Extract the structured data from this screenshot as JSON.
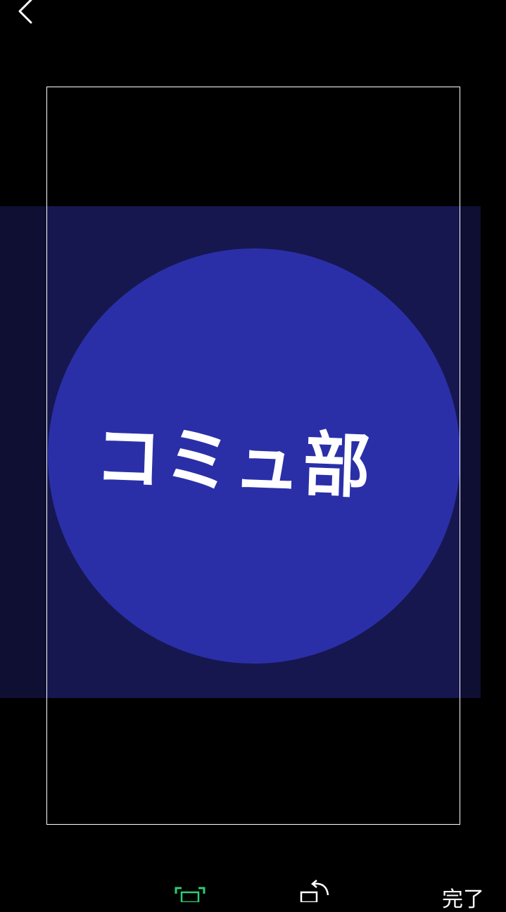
{
  "header": {
    "back_icon": "chevron-left-icon"
  },
  "image": {
    "logo_text": "コミュ部",
    "background_color": "#16174f",
    "circle_color": "#2a2fa8"
  },
  "toolbar": {
    "crop_icon": "crop-icon",
    "crop_active_color": "#2ecc71",
    "rotate_icon": "rotate-icon",
    "done_label": "完了"
  }
}
